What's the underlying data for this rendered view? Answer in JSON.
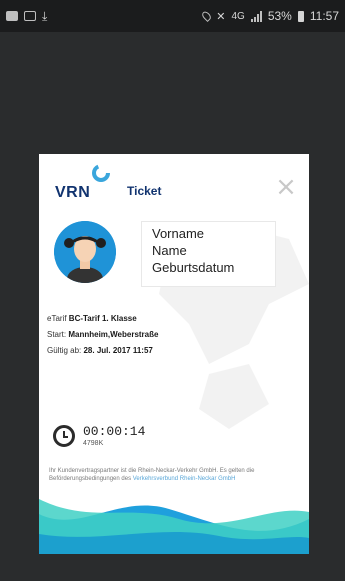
{
  "status_bar": {
    "network": "4G",
    "battery": "53%",
    "time": "11:57",
    "icons": [
      "photo-icon",
      "image-icon",
      "download-icon",
      "location-icon",
      "mute-icon",
      "signal-icon",
      "battery-icon"
    ]
  },
  "card": {
    "logo_text": "VRN",
    "ticket_label": "Ticket",
    "close_symbol": "×",
    "info": {
      "first_name": "Vorname",
      "last_name": "Name",
      "birthdate": "Geburtsdatum"
    },
    "lines": {
      "tariff_prefix": "eTarif",
      "tariff_value": "BC-Tarif 1. Klasse",
      "start_prefix": "Start:",
      "start_value": "Mannheim,Weberstraße",
      "valid_prefix": "Gültig ab:",
      "valid_value": "28. Jul. 2017 11:57"
    },
    "timer": {
      "time": "00:00:14",
      "code": "4798K"
    },
    "legal": {
      "text": "Ihr Kundenvertragspartner ist die Rhein-Neckar-Verkehr GmbH. Es gelten die Beförderungsbedingungen des Verkehrsverbund Rhein-Neckar GmbH",
      "text_part1": "Ihr Kundenvertragspartner ist die Rhein-Neckar-Verkehr GmbH. Es",
      "text_part2": "gelten die Beförderungsbedingungen des",
      "text_link": "Verkehrsverbund Rhein-Neckar GmbH"
    },
    "colors": {
      "brand": "#11336f",
      "swirl": "#3aa6dc",
      "avatar_bg": "#1f93d7",
      "wave_teal": "#3fd0c4",
      "wave_blue": "#1fa0dd"
    }
  }
}
